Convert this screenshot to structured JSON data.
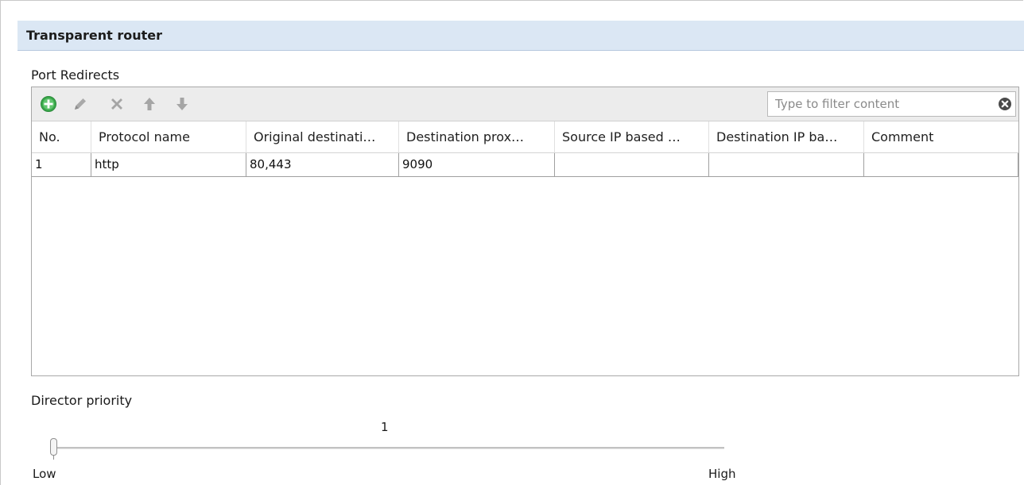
{
  "panel": {
    "title": "Transparent router"
  },
  "port_redirects": {
    "label": "Port Redirects",
    "toolbar": {
      "add_icon": "add-icon",
      "edit_icon": "pencil-icon",
      "delete_icon": "delete-icon",
      "move_up_icon": "arrow-up-icon",
      "move_down_icon": "arrow-down-icon",
      "filter_placeholder": "Type to filter content",
      "filter_value": "",
      "clear_icon": "clear-circle-icon"
    },
    "columns": [
      "No.",
      "Protocol name",
      "Original destinati…",
      "Destination prox…",
      "Source IP based …",
      "Destination IP ba…",
      "Comment"
    ],
    "rows": [
      [
        "1",
        "http",
        "80,443",
        "9090",
        "",
        "",
        ""
      ]
    ]
  },
  "director_priority": {
    "label": "Director priority",
    "value": "1",
    "min_label": "Low",
    "max_label": "High",
    "level_fraction": 0
  },
  "colors": {
    "title_bar_bg": "#dbe7f4",
    "toolbar_bg": "#ececec",
    "add_green": "#3aa84b"
  }
}
